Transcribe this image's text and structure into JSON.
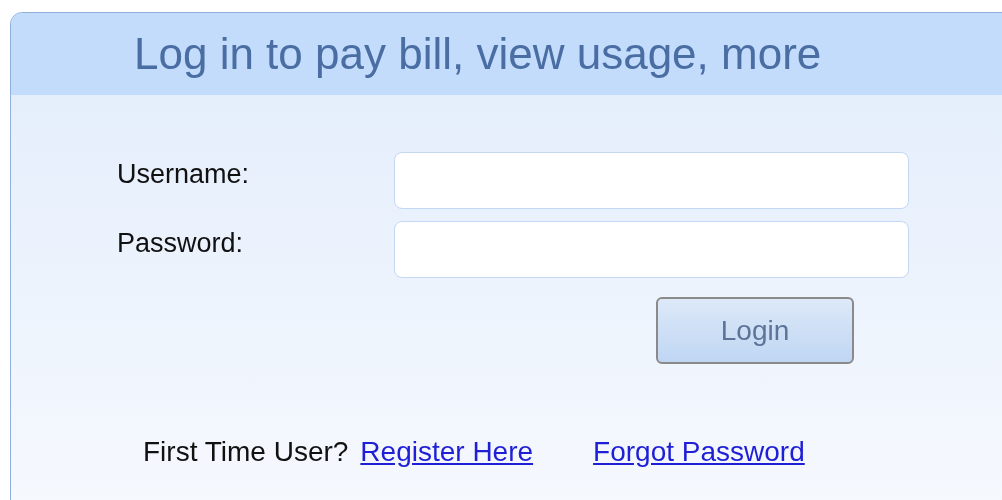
{
  "title": "Log in to pay bill, view usage, more",
  "fields": [
    {
      "label": "Username:"
    },
    {
      "label": "Password:"
    }
  ],
  "button": "Login",
  "footer": {
    "prompt": "First Time User?",
    "links": [
      "Register Here",
      "Forgot Password"
    ]
  }
}
